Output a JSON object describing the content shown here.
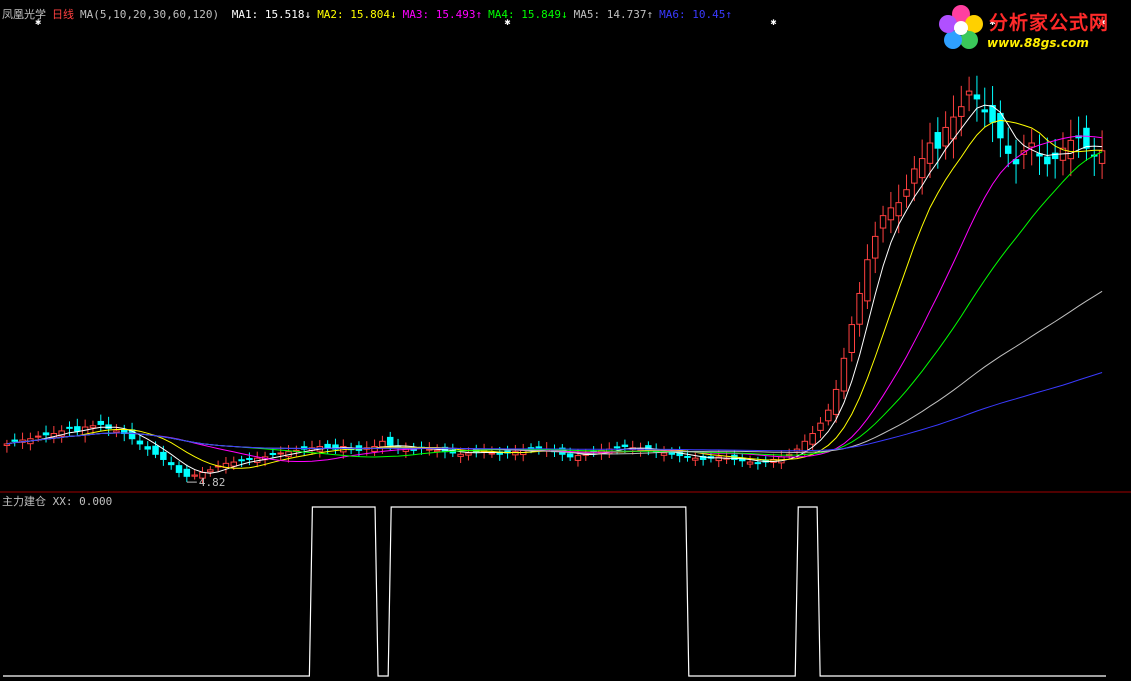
{
  "header": {
    "stock_name": "凤凰光学",
    "period": "日线",
    "ma_params": "MA(5,10,20,30,60,120)",
    "ma_readouts": [
      {
        "label": "MA1:",
        "value": "15.518",
        "dir": "↓",
        "color": "#ffffff"
      },
      {
        "label": "MA2:",
        "value": "15.804",
        "dir": "↓",
        "color": "#ffff00"
      },
      {
        "label": "MA3:",
        "value": "15.493",
        "dir": "↑",
        "color": "#ff00ff"
      },
      {
        "label": "MA4:",
        "value": "15.849",
        "dir": "↓",
        "color": "#00ff00"
      },
      {
        "label": "MA5:",
        "value": "14.737",
        "dir": "↑",
        "color": "#c0c0c0"
      },
      {
        "label": "MA6:",
        "value": "10.45",
        "dir": "↑",
        "color": "#3a3aff"
      }
    ]
  },
  "logo": {
    "title": "分析家公式网",
    "url": "www.88gs.com"
  },
  "indicator": {
    "name": "主力建仓",
    "readout": "XX: 0.000"
  },
  "chart_data": [
    {
      "type": "candlestick",
      "title": "凤凰光学 日线",
      "annotations": [
        {
          "text": "4.82",
          "label": "lowest low"
        }
      ],
      "y_scale": {
        "low": 4.5,
        "high": 21.0
      },
      "colors": {
        "up": "#ff4040",
        "down": "#00ffff"
      },
      "moving_averages": [
        {
          "name": "MA1",
          "period": 5,
          "color": "#ffffff"
        },
        {
          "name": "MA2",
          "period": 10,
          "color": "#ffff00"
        },
        {
          "name": "MA3",
          "period": 20,
          "color": "#ff00ff"
        },
        {
          "name": "MA4",
          "period": 30,
          "color": "#00ff00"
        },
        {
          "name": "MA5",
          "period": 60,
          "color": "#c0c0c0"
        },
        {
          "name": "MA6",
          "period": 120,
          "color": "#3a3aff"
        }
      ],
      "closes": [
        6.2,
        6.3,
        6.35,
        6.4,
        6.5,
        6.55,
        6.6,
        6.7,
        6.8,
        6.7,
        6.85,
        6.9,
        6.95,
        6.8,
        6.7,
        6.6,
        6.4,
        6.2,
        6.0,
        5.8,
        5.6,
        5.4,
        5.1,
        4.95,
        5.0,
        5.1,
        5.2,
        5.35,
        5.45,
        5.5,
        5.55,
        5.6,
        5.65,
        5.7,
        5.8,
        5.85,
        5.9,
        5.95,
        6.0,
        6.05,
        6.1,
        6.05,
        6.0,
        6.1,
        6.0,
        5.95,
        6.05,
        6.1,
        6.3,
        6.15,
        6.05,
        6.0,
        5.95,
        6.05,
        6.0,
        5.95,
        5.9,
        5.85,
        5.8,
        5.85,
        5.9,
        5.95,
        5.85,
        5.8,
        5.85,
        5.9,
        5.95,
        6.0,
        6.05,
        6.0,
        5.9,
        5.8,
        5.7,
        5.75,
        5.8,
        5.9,
        5.95,
        6.0,
        6.05,
        6.1,
        6.05,
        6.0,
        5.95,
        5.9,
        5.85,
        5.8,
        5.75,
        5.7,
        5.65,
        5.6,
        5.65,
        5.7,
        5.65,
        5.6,
        5.55,
        5.5,
        5.45,
        5.5,
        5.6,
        5.7,
        5.8,
        6.0,
        6.3,
        6.6,
        7.0,
        7.5,
        8.3,
        9.5,
        10.8,
        12.0,
        13.3,
        14.2,
        15.0,
        15.3,
        15.5,
        16.0,
        16.8,
        17.2,
        17.8,
        17.6,
        18.4,
        18.8,
        19.2,
        19.8,
        19.5,
        19.0,
        18.6,
        18.0,
        17.4,
        17.0,
        17.5,
        17.8,
        17.3,
        17.0,
        17.2,
        17.6,
        17.9,
        18.0,
        17.6,
        17.3,
        17.5
      ],
      "ma_last_values": {
        "MA1": 15.518,
        "MA2": 15.804,
        "MA3": 15.493,
        "MA4": 15.849,
        "MA5": 14.737,
        "MA6": 10.45
      }
    },
    {
      "type": "line",
      "title": "主力建仓",
      "series": [
        {
          "name": "XX",
          "values_segments": [
            {
              "from_bar": 0,
              "to_bar": 69,
              "value": 0
            },
            {
              "from_bar": 70,
              "to_bar": 84,
              "value": 1
            },
            {
              "from_bar": 85,
              "to_bar": 87,
              "value": 0
            },
            {
              "from_bar": 88,
              "to_bar": 155,
              "value": 1
            },
            {
              "from_bar": 156,
              "to_bar": 180,
              "value": 0
            },
            {
              "from_bar": 181,
              "to_bar": 185,
              "value": 1
            },
            {
              "from_bar": 186,
              "to_bar": 251,
              "value": 0
            }
          ]
        }
      ],
      "last_value": 0.0,
      "ylim": [
        0,
        1
      ]
    }
  ]
}
